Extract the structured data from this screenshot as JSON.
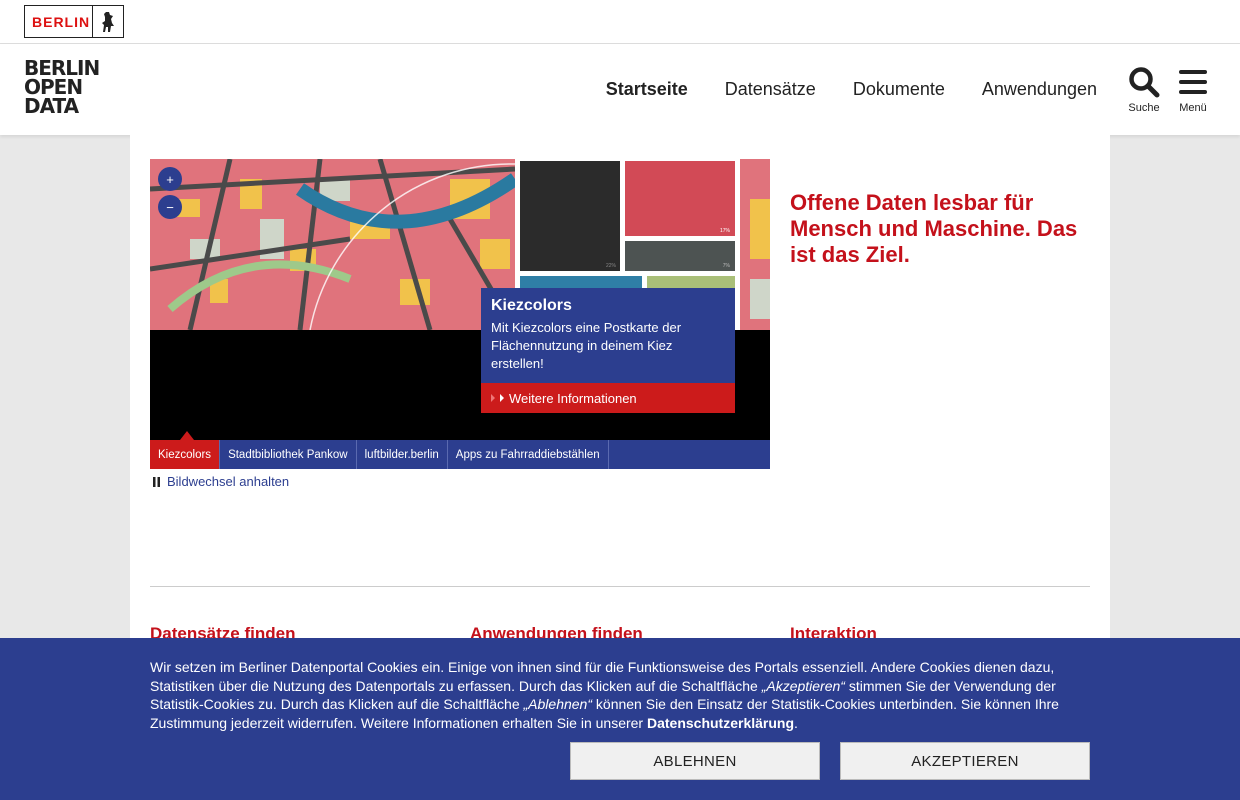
{
  "state_logo": {
    "text": "BERLIN"
  },
  "site_logo": {
    "lines": [
      "BERLIN",
      "OPEN",
      "DATA"
    ]
  },
  "nav": {
    "items": [
      "Startseite",
      "Datensätze",
      "Dokumente",
      "Anwendungen"
    ],
    "search_label": "Suche",
    "menu_label": "Menü"
  },
  "slider": {
    "zoom_in": "+",
    "zoom_out": "−",
    "info_title": "Kiezcolors",
    "info_text": "Mit Kiezcolors eine Postkarte der Flächennutzung in deinem Kiez erstellen!",
    "more_label": "Weitere Informationen",
    "tabs": [
      "Kiezcolors",
      "Stadtbibliothek Pankow",
      "luftbilder.berlin",
      "Apps zu Fahrraddiebstählen"
    ],
    "pause_label": "Bildwechsel anhalten",
    "treemap_labels": [
      "17%",
      "22%",
      "7%"
    ]
  },
  "headline": "Offene Daten lesbar für Mensch und Maschine. Das ist das Ziel.",
  "sections": [
    "Datensätze finden",
    "Anwendungen finden",
    "Interaktion"
  ],
  "cookie": {
    "text_1": "Wir setzen im Berliner Datenportal Cookies ein. Einige von ihnen sind für die Funktionsweise des Portals essenziell. Andere Cookies dienen dazu, Statistiken über die Nutzung des Datenportals zu erfassen. Durch das Klicken auf die Schaltfläche ",
    "accept_quote": "„Akzeptieren“",
    "text_2": " stimmen Sie der Verwendung der Statistik-Cookies zu. Durch das Klicken auf die Schaltfläche ",
    "reject_quote": "„Ablehnen“",
    "text_3": " können Sie den Einsatz der Statistik-Cookies unterbinden. Sie können Ihre Zustimmung jederzeit widerrufen. Weitere Informationen erhalten Sie in unserer ",
    "privacy_link": "Datenschutzerklärung",
    "text_4": ".",
    "reject_button": "ABLEHNEN",
    "accept_button": "AKZEPTIEREN"
  },
  "colors": {
    "brand_red": "#c4111b",
    "brand_blue": "#2c3e8f"
  }
}
